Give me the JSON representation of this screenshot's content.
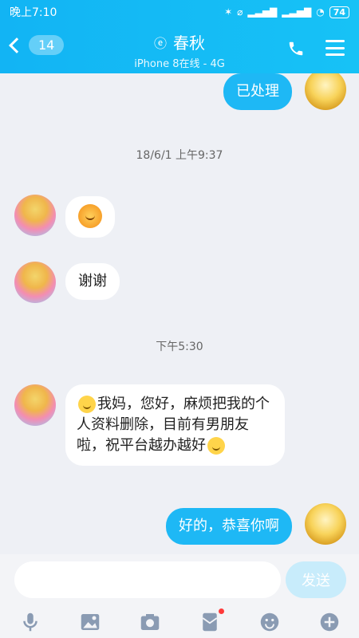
{
  "status_bar": {
    "time": "晚上7:10",
    "battery": "74"
  },
  "header": {
    "unread_count": "14",
    "title": "春秋",
    "subtitle": "iPhone 8在线 - 4G"
  },
  "messages": [
    {
      "side": "right",
      "text": "已处理"
    },
    {
      "type": "time",
      "text": "18/6/1 上午9:37"
    },
    {
      "side": "left",
      "type": "emoji",
      "emoji_name": "sun-emoji"
    },
    {
      "side": "left",
      "text": "谢谢"
    },
    {
      "type": "time",
      "text": "下午5:30"
    },
    {
      "side": "left",
      "text": "我妈，您好，麻烦把我的个人资料删除，目前有男朋友啦，祝平台越办越好"
    },
    {
      "side": "right",
      "text": "好的，恭喜你啊"
    }
  ],
  "input": {
    "placeholder": "",
    "value": "",
    "send_label": "发送"
  },
  "toolbar": {
    "items": [
      {
        "name": "voice-icon"
      },
      {
        "name": "image-icon"
      },
      {
        "name": "camera-icon"
      },
      {
        "name": "red-packet-icon"
      },
      {
        "name": "emoji-icon"
      },
      {
        "name": "plus-icon"
      }
    ]
  },
  "colors": {
    "brand": "#12b4f4",
    "bubble_right": "#1eb8f5",
    "bubble_left": "#ffffff",
    "background": "#eef0f5"
  }
}
